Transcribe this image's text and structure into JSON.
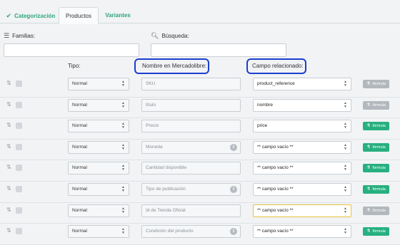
{
  "tabs": [
    {
      "label": "Categorización",
      "checked": true
    },
    {
      "label": "Productos",
      "active": true
    },
    {
      "label": "Variantes"
    }
  ],
  "filters": {
    "familias_label": "Familias:",
    "familias_value": "",
    "busqueda_label": "Búsqueda:",
    "busqueda_value": ""
  },
  "columns": {
    "tipo": "Tipo:",
    "nombre": "Nombre en Mercadolibre:",
    "campo": "Campo relacionado:"
  },
  "formula_label": "fórmula",
  "colors": {
    "accent": "#2fa67a",
    "formula_green": "#27b07f",
    "formula_gray": "#b3b8bd",
    "highlight": "#1c3fd0"
  },
  "rows": [
    {
      "tipo": "Normal",
      "nombre": "SKU",
      "info": false,
      "campo": "product_reference",
      "formula": "gray",
      "focus": false
    },
    {
      "tipo": "Normal",
      "nombre": "título",
      "info": false,
      "campo": "nombre",
      "formula": "gray",
      "focus": false
    },
    {
      "tipo": "Normal",
      "nombre": "Precio",
      "info": false,
      "campo": "price",
      "formula": "green",
      "focus": false
    },
    {
      "tipo": "Normal",
      "nombre": "Moneda",
      "info": true,
      "campo": "** campo vacío **",
      "formula": "green",
      "focus": false
    },
    {
      "tipo": "Normal",
      "nombre": "Cantidad disponible",
      "info": false,
      "campo": "** campo vacío **",
      "formula": "green",
      "focus": false
    },
    {
      "tipo": "Normal",
      "nombre": "Tipo de publicación",
      "info": true,
      "campo": "** campo vacío **",
      "formula": "green",
      "focus": false
    },
    {
      "tipo": "Normal",
      "nombre": "Id de Tienda Oficial",
      "info": false,
      "campo": "** campo vacío **",
      "formula": "gray",
      "focus": true
    },
    {
      "tipo": "Normal",
      "nombre": "Condición del producto",
      "info": true,
      "campo": "** campo vacío **",
      "formula": "green",
      "focus": false
    }
  ]
}
